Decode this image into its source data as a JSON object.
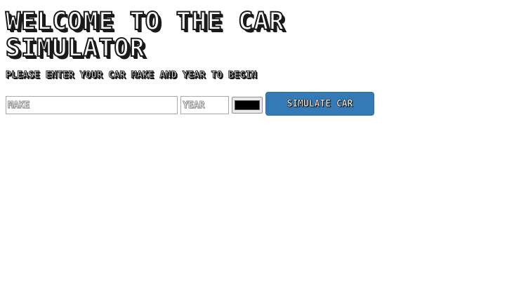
{
  "header": {
    "title": "WELCOME TO THE CAR SIMULATOR",
    "subtitle": "PLEASE ENTER YOUR CAR MAKE AND YEAR TO BEGIN"
  },
  "form": {
    "make_placeholder": "MAKE",
    "make_value": "",
    "year_placeholder": "YEAR",
    "year_value": "",
    "color_value": "#000000",
    "submit_label": "SIMULATE CAR"
  },
  "colors": {
    "button_bg": "#337ab7",
    "text_outline": "#1a1a1a"
  }
}
